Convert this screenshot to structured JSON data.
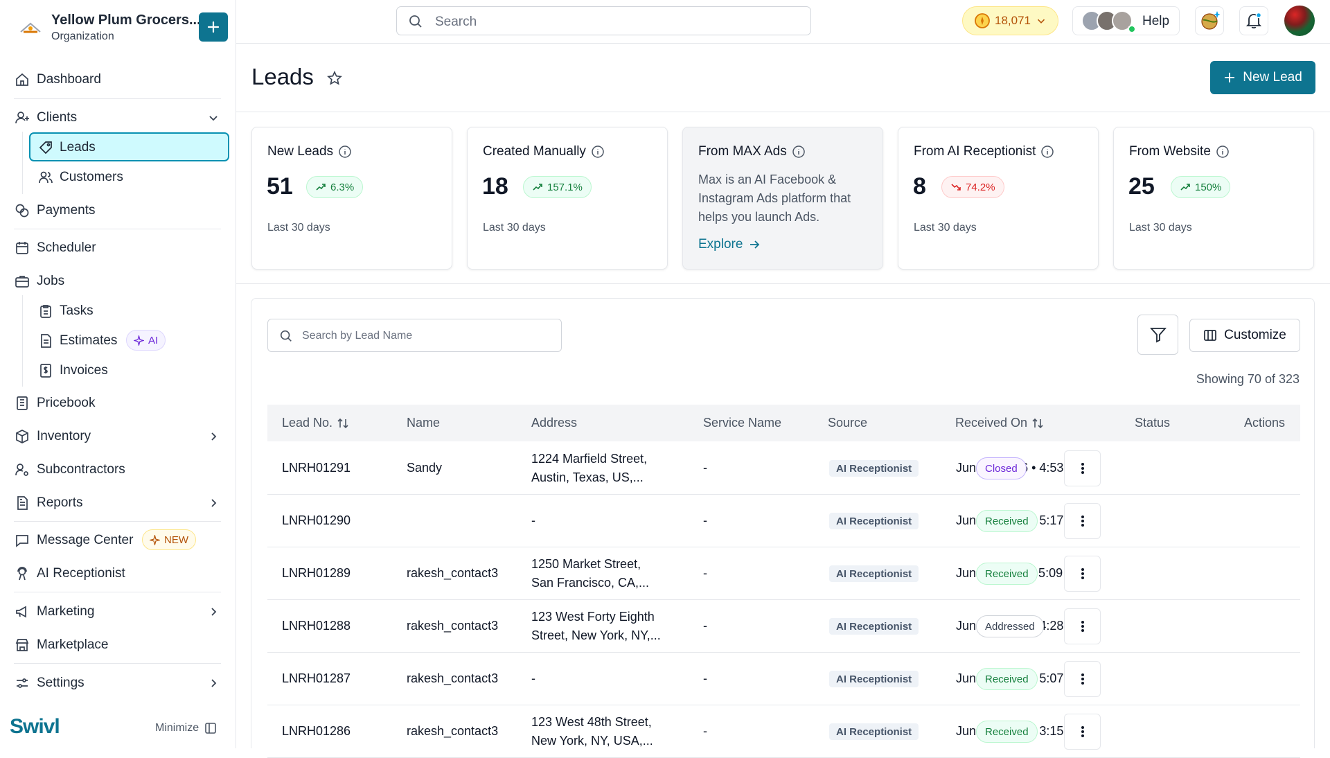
{
  "org": {
    "name": "Yellow Plum Grocers...",
    "subtitle": "Organization"
  },
  "nav": {
    "dashboard": "Dashboard",
    "clients": "Clients",
    "leads": "Leads",
    "customers": "Customers",
    "payments": "Payments",
    "scheduler": "Scheduler",
    "jobs": "Jobs",
    "tasks": "Tasks",
    "estimates": "Estimates",
    "estimates_badge": "AI",
    "invoices": "Invoices",
    "pricebook": "Pricebook",
    "inventory": "Inventory",
    "subcontractors": "Subcontractors",
    "reports": "Reports",
    "message_center": "Message Center",
    "message_center_badge": "NEW",
    "ai_receptionist": "AI Receptionist",
    "marketing": "Marketing",
    "marketplace": "Marketplace",
    "settings": "Settings"
  },
  "footer": {
    "brand": "Swivl",
    "minimize": "Minimize"
  },
  "topbar": {
    "search_placeholder": "Search",
    "coins": "18,071",
    "help": "Help"
  },
  "page": {
    "title": "Leads",
    "new_lead": "New Lead"
  },
  "stats": [
    {
      "title": "New Leads",
      "value": "51",
      "change": "6.3%",
      "trend": "up",
      "period": "Last 30 days"
    },
    {
      "title": "Created Manually",
      "value": "18",
      "change": "157.1%",
      "trend": "up",
      "period": "Last 30 days"
    },
    {
      "title": "From MAX Ads",
      "description": "Max is an AI Facebook & Instagram Ads platform that helps you launch Ads.",
      "link": "Explore"
    },
    {
      "title": "From AI Receptionist",
      "value": "8",
      "change": "74.2%",
      "trend": "down",
      "period": "Last 30 days"
    },
    {
      "title": "From Website",
      "value": "25",
      "change": "150%",
      "trend": "up",
      "period": "Last 30 days"
    }
  ],
  "table": {
    "search_placeholder": "Search by Lead Name",
    "customize": "Customize",
    "showing": "Showing 70 of 323",
    "columns": [
      "Lead No.",
      "Name",
      "Address",
      "Service Name",
      "Source",
      "Received On",
      "Status",
      "Actions"
    ],
    "rows": [
      {
        "lead_no": "LNRH01291",
        "name": "Sandy",
        "address1": "1224 Marfield Street,",
        "address2": "Austin, Texas, US,...",
        "service": "-",
        "source": "AI Receptionist",
        "received": "Jun 15, 2026 • 4:53 PM",
        "status": "Closed"
      },
      {
        "lead_no": "LNRH01290",
        "name": "",
        "address1": "-",
        "address2": "",
        "service": "-",
        "source": "AI Receptionist",
        "received": "Jun 12, 2026 • 5:17 PM",
        "status": "Received"
      },
      {
        "lead_no": "LNRH01289",
        "name": "rakesh_contact3",
        "address1": "1250 Market Street,",
        "address2": "San Francisco, CA,...",
        "service": "-",
        "source": "AI Receptionist",
        "received": "Jun 11, 2026 • 5:09 PM",
        "status": "Received"
      },
      {
        "lead_no": "LNRH01288",
        "name": "rakesh_contact3",
        "address1": "123 West Forty Eighth",
        "address2": "Street, New York, NY,...",
        "service": "-",
        "source": "AI Receptionist",
        "received": "Jun 10, 2026 • 4:28 PM",
        "status": "Addressed"
      },
      {
        "lead_no": "LNRH01287",
        "name": "rakesh_contact3",
        "address1": "-",
        "address2": "",
        "service": "-",
        "source": "AI Receptionist",
        "received": "Jun 09, 2026 • 5:07 PM",
        "status": "Received"
      },
      {
        "lead_no": "LNRH01286",
        "name": "rakesh_contact3",
        "address1": "123 West 48th Street,",
        "address2": "New York, NY, USA,...",
        "service": "-",
        "source": "AI Receptionist",
        "received": "Jun 09, 2026 • 3:15 PM",
        "status": "Received"
      }
    ]
  },
  "colors": {
    "brand": "#0e7490",
    "active_bg": "#cffafe",
    "up": "#15803d",
    "down": "#dc2626"
  }
}
